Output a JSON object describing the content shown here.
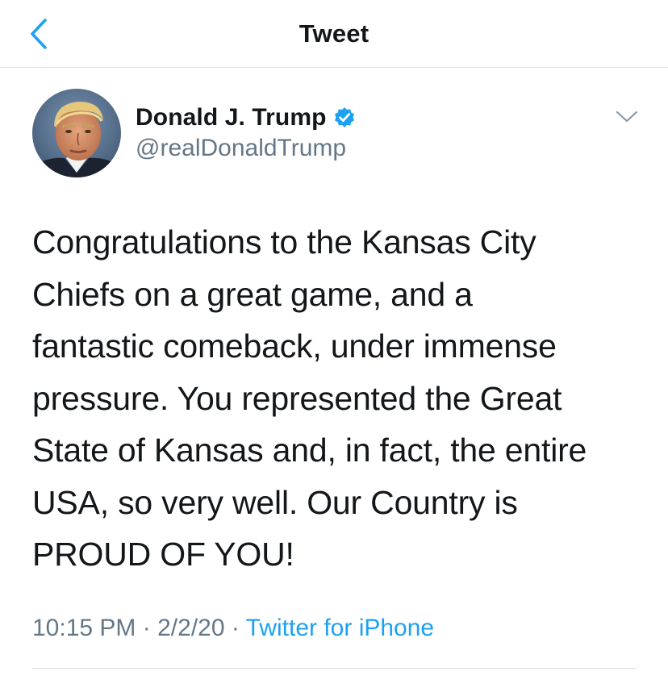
{
  "header": {
    "title": "Tweet",
    "back_icon": "chevron-left-icon"
  },
  "author": {
    "name": "Donald J. Trump",
    "handle": "@realDonaldTrump",
    "verified": true,
    "avatar_icon": "avatar-photo",
    "menu_icon": "chevron-down-icon"
  },
  "tweet": {
    "text": "Congratulations to the Kansas City\nChiefs on a great game, and a\nfantastic comeback, under immense\npressure. You represented the Great\nState of Kansas and, in fact, the entire\nUSA, so very well. Our Country is\nPROUD OF YOU!"
  },
  "meta": {
    "time": "10:15 PM",
    "separator": "·",
    "date": "2/2/20",
    "source": "Twitter for iPhone"
  },
  "colors": {
    "accent": "#1da1f2",
    "text": "#14171a",
    "secondary": "#657786",
    "divider": "#d9dde1"
  }
}
